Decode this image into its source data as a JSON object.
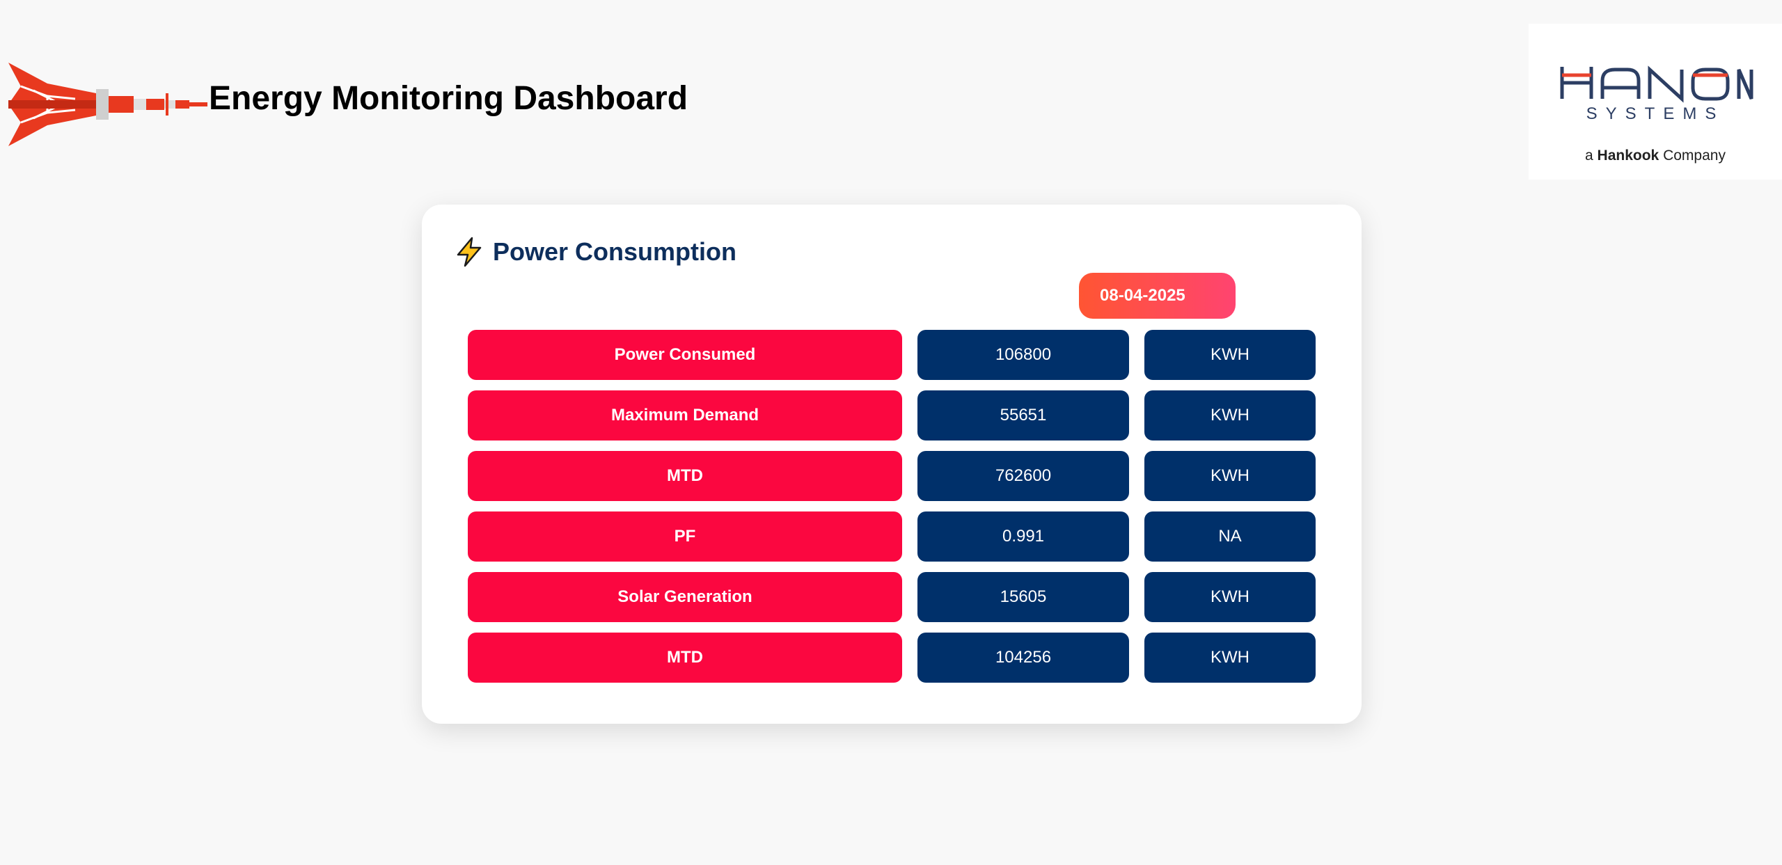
{
  "header": {
    "title": "Energy Monitoring Dashboard",
    "logo_icon": "transmission-tower-icon",
    "brand": {
      "name": "HANON",
      "sub": "SYSTEMS",
      "tagline_prefix": "a ",
      "tagline_brand": "Hankook",
      "tagline_suffix": " Company"
    }
  },
  "card": {
    "icon": "lightning-bolt-icon",
    "title": "Power Consumption",
    "date": "08-04-2025",
    "rows": [
      {
        "label": "Power Consumed",
        "value": "106800",
        "unit": "KWH"
      },
      {
        "label": "Maximum Demand",
        "value": "55651",
        "unit": "KWH"
      },
      {
        "label": "MTD",
        "value": "762600",
        "unit": "KWH"
      },
      {
        "label": "PF",
        "value": "0.991",
        "unit": "NA"
      },
      {
        "label": "Solar Generation",
        "value": "15605",
        "unit": "KWH"
      },
      {
        "label": "MTD",
        "value": "104256",
        "unit": "KWH"
      }
    ]
  },
  "colors": {
    "label_bg": "#fb0740",
    "value_bg": "#00306a",
    "title_color": "#0d2e5c",
    "brand_red": "#e8432e",
    "brand_blue": "#2c3e63"
  }
}
